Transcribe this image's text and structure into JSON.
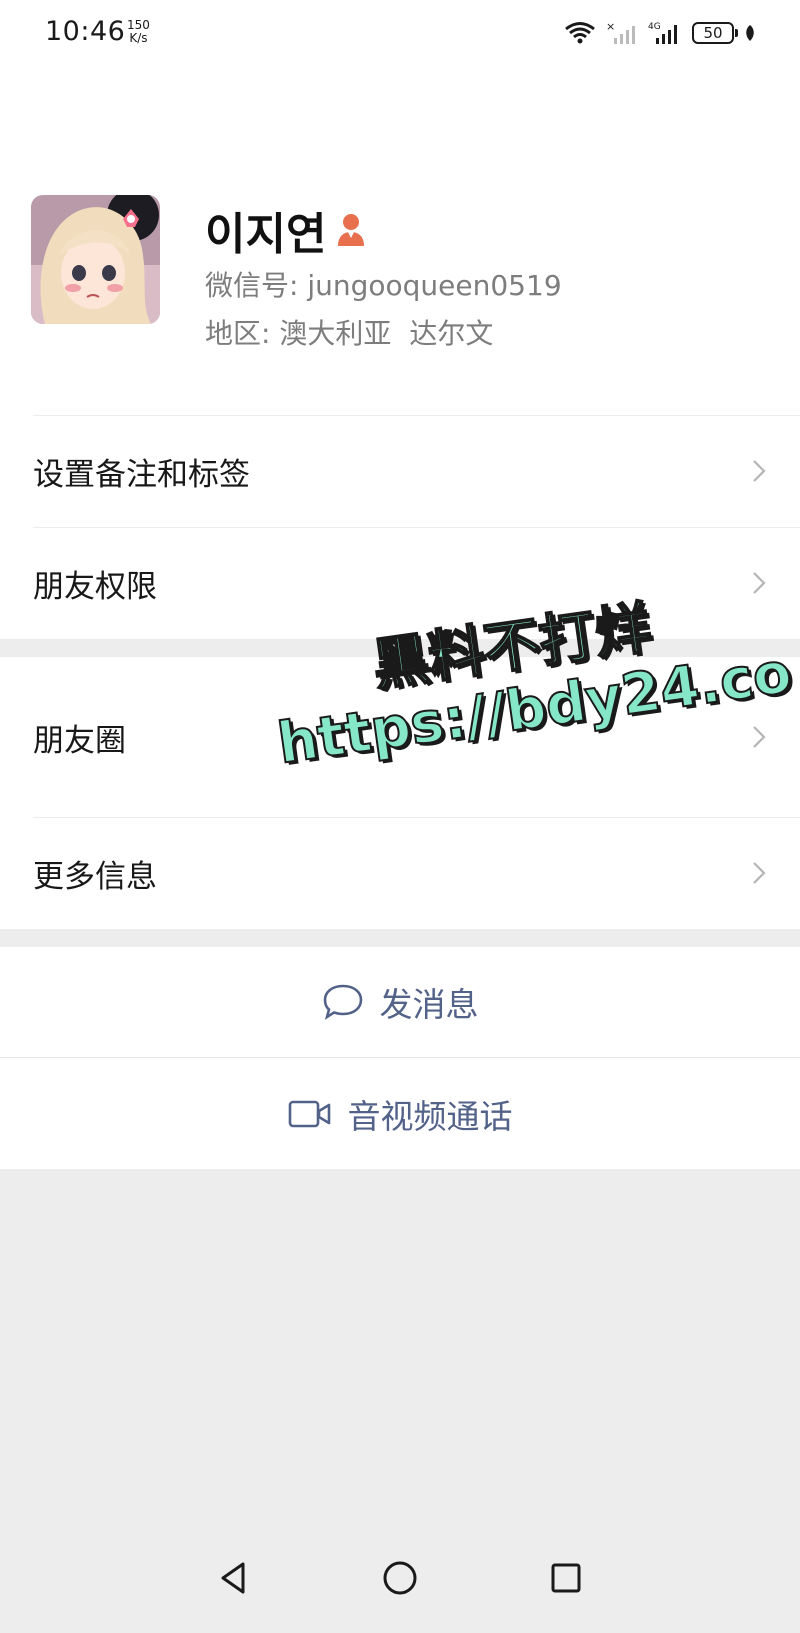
{
  "status_bar": {
    "time": "10:46",
    "speed_value": "150",
    "speed_unit": "K/s",
    "battery": "50",
    "icons": [
      "wifi-icon",
      "no-signal-icon",
      "4g-signal-icon",
      "battery-icon",
      "leaf-icon"
    ]
  },
  "profile": {
    "name": "이지연",
    "gender_icon": "female-icon",
    "wechat_id_label": "微信号:",
    "wechat_id": "jungooqueen0519",
    "region_label": "地区:",
    "region_country": "澳大利亚",
    "region_city": "达尔文"
  },
  "section1": {
    "items": [
      {
        "label": "设置备注和标签",
        "icon": "chevron-right-icon"
      },
      {
        "label": "朋友权限",
        "icon": "chevron-right-icon"
      }
    ]
  },
  "section2": {
    "items": [
      {
        "label": "朋友圈",
        "icon": "chevron-right-icon"
      },
      {
        "label": "更多信息",
        "icon": "chevron-right-icon"
      }
    ]
  },
  "actions": {
    "message": {
      "label": "发消息",
      "icon": "chat-bubble-icon"
    },
    "video_call": {
      "label": "音视频通话",
      "icon": "video-camera-icon"
    }
  },
  "watermark": {
    "line1": "黑料不打烊",
    "line2": "https://bdy24.co"
  },
  "nav_bar": {
    "icons": [
      "back-triangle-icon",
      "home-circle-icon",
      "recents-square-icon"
    ]
  },
  "colors": {
    "background": "#ededed",
    "card": "#ffffff",
    "action_text": "#536289",
    "secondary_text": "#7d7d7d",
    "gender_icon": "#e9704f",
    "watermark_fill": "#86e7c8"
  }
}
